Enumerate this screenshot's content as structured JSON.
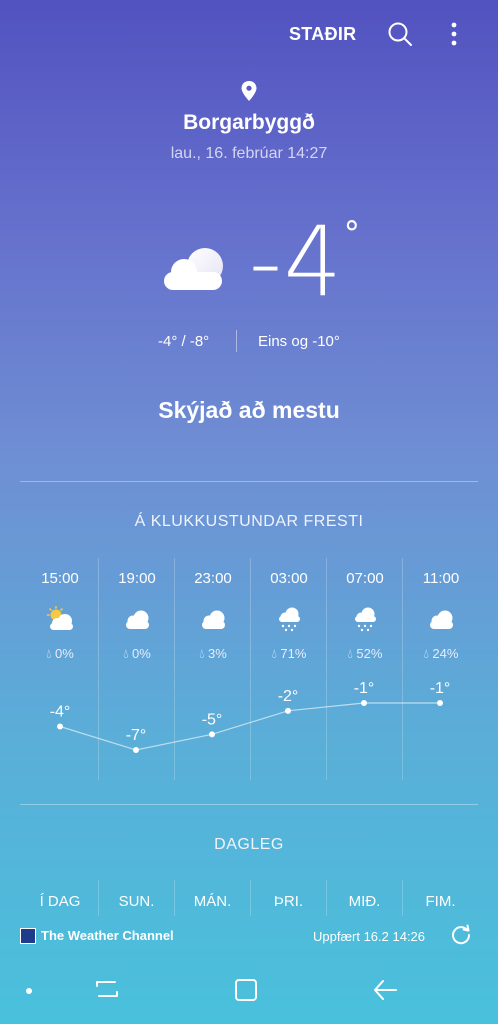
{
  "header": {
    "places_label": "STAÐIR",
    "search_icon": "search-icon",
    "more_icon": "more-vert-icon"
  },
  "location": {
    "name": "Borgarbyggð",
    "datetime": "lau., 16. febrúar 14:27"
  },
  "current": {
    "temp": "-4",
    "degree": "°",
    "icon": "cloud-icon",
    "hi_lo": "-4°  /  -8°",
    "feels_like": "Eins og -10°",
    "condition": "Skýjað að mestu"
  },
  "hourly": {
    "title": "Á KLUKKUSTUNDAR FRESTI",
    "items": [
      {
        "time": "15:00",
        "icon": "partly-sunny-icon",
        "precip": "0%",
        "temp": "-4°",
        "temp_value": -4
      },
      {
        "time": "19:00",
        "icon": "cloud-icon",
        "precip": "0%",
        "temp": "-7°",
        "temp_value": -7
      },
      {
        "time": "23:00",
        "icon": "cloud-icon",
        "precip": "3%",
        "temp": "-5°",
        "temp_value": -5
      },
      {
        "time": "03:00",
        "icon": "snow-icon",
        "precip": "71%",
        "temp": "-2°",
        "temp_value": -2
      },
      {
        "time": "07:00",
        "icon": "snow-icon",
        "precip": "52%",
        "temp": "-1°",
        "temp_value": -1
      },
      {
        "time": "11:00",
        "icon": "cloud-icon",
        "precip": "24%",
        "temp": "-1°",
        "temp_value": -1
      }
    ]
  },
  "daily": {
    "title": "DAGLEG",
    "days": [
      "Í DAG",
      "SUN.",
      "MÁN.",
      "ÞRI.",
      "MIÐ.",
      "FIM."
    ]
  },
  "footer": {
    "provider": "The Weather Channel",
    "updated": "Uppfært  16.2  14:26",
    "refresh_icon": "refresh-icon"
  },
  "colors": {
    "bg_top": "#5252c0",
    "bg_bottom": "#49c1dc",
    "text": "#ffffff"
  }
}
